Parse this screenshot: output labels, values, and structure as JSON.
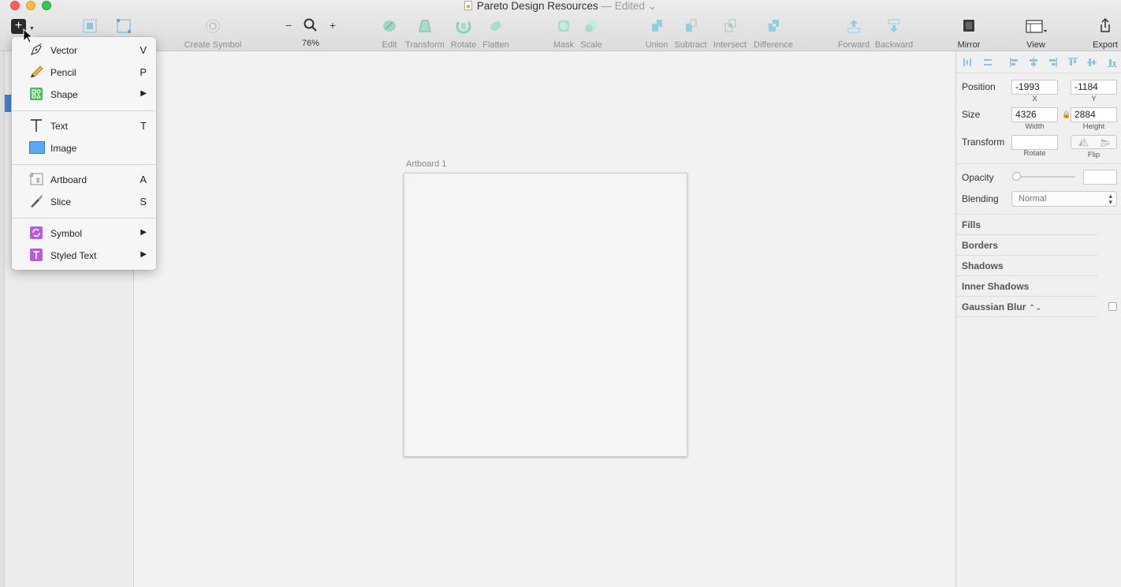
{
  "window": {
    "title": "Pareto Design Resources",
    "edited": "— Edited ⌄"
  },
  "toolbar": {
    "insert_glyph": "+",
    "create_symbol": "Create Symbol",
    "zoom_minus": "−",
    "zoom_plus": "+",
    "zoom_level": "76%",
    "edit": "Edit",
    "transform": "Transform",
    "rotate": "Rotate",
    "flatten": "Flatten",
    "mask": "Mask",
    "scale": "Scale",
    "union": "Union",
    "subtract": "Subtract",
    "intersect": "Intersect",
    "difference": "Difference",
    "forward": "Forward",
    "backward": "Backward",
    "mirror": "Mirror",
    "view": "View",
    "export": "Export"
  },
  "insert_menu": {
    "items": [
      {
        "label": "Vector",
        "shortcut": "V",
        "icon": "pen-icon"
      },
      {
        "label": "Pencil",
        "shortcut": "P",
        "icon": "pencil-icon"
      },
      {
        "label": "Shape",
        "submenu": "▶",
        "icon": "shape-icon"
      },
      {
        "label": "Text",
        "shortcut": "T",
        "icon": "text-icon"
      },
      {
        "label": "Image",
        "icon": "image-icon"
      },
      {
        "label": "Artboard",
        "shortcut": "A",
        "icon": "artboard-icon"
      },
      {
        "label": "Slice",
        "shortcut": "S",
        "icon": "slice-icon"
      },
      {
        "label": "Symbol",
        "submenu": "▶",
        "icon": "symbol-icon"
      },
      {
        "label": "Styled Text",
        "submenu": "▶",
        "icon": "styled-text-icon"
      }
    ]
  },
  "canvas": {
    "artboard_label": "Artboard 1"
  },
  "inspector": {
    "position_label": "Position",
    "position_x": "-1993",
    "position_y": "-1184",
    "x_label": "X",
    "y_label": "Y",
    "size_label": "Size",
    "width": "4326",
    "height": "2884",
    "width_label": "Width",
    "height_label": "Height",
    "transform_label": "Transform",
    "rotate_label": "Rotate",
    "flip_label": "Flip",
    "opacity_label": "Opacity",
    "blending_label": "Blending",
    "blending_value": "Normal",
    "fills": "Fills",
    "borders": "Borders",
    "shadows": "Shadows",
    "inner_shadows": "Inner Shadows",
    "gaussian_blur": "Gaussian Blur"
  },
  "colors": {
    "accent": "#4a7fd1",
    "icon_teal": "#8fd3c9",
    "symbol_purple": "#b95cd6",
    "shape_green": "#4cbe5a"
  }
}
